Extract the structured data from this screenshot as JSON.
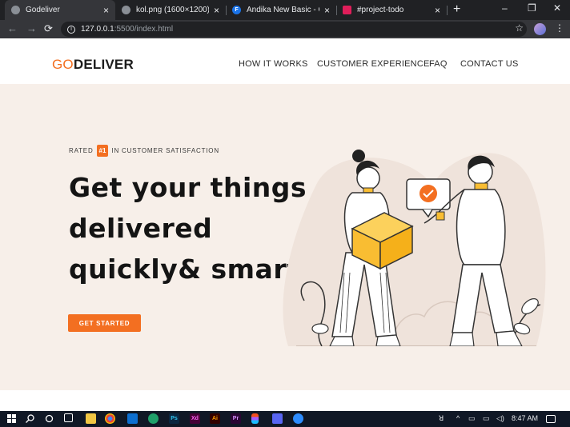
{
  "browser": {
    "tabs": [
      {
        "title": "Godeliver",
        "active": true,
        "favicon_color": "#8a8f96"
      },
      {
        "title": "kol.png (1600×1200)",
        "active": false,
        "favicon_color": "#8a8f96"
      },
      {
        "title": "Andika New Basic - Goog",
        "active": false,
        "favicon_color": "#1a73e8",
        "favicon_letter": "F"
      },
      {
        "title": "#project-todo",
        "active": false,
        "favicon_color": "#e01e5a"
      }
    ],
    "close_glyph": "×",
    "new_tab_glyph": "+",
    "window_controls": [
      "–",
      "❐",
      "✕"
    ],
    "url_host": "127.0.0.1",
    "url_rest": ":5500/index.html",
    "nav_glyphs": {
      "back": "←",
      "forward": "→",
      "reload": "⟳",
      "star": "☆",
      "menu": "⋮"
    }
  },
  "site": {
    "logo_go": "GO",
    "logo_deliver": "DELIVER",
    "nav": [
      "HOW IT WORKS",
      "CUSTOMER EXPERIENCE",
      "FAQ",
      "CONTACT US"
    ],
    "rated_prefix": "RATED",
    "rated_badge": "#1",
    "rated_suffix": "IN CUSTOMER SATISFACTION",
    "headline": [
      "Get your things",
      "delivered",
      "quickly& smartly"
    ],
    "cta_label": "GET STARTED",
    "colors": {
      "accent": "#f36f21",
      "hero_bg": "#f7efe9",
      "box": "#f9bd32"
    }
  },
  "taskbar": {
    "time": "8:47 AM",
    "tray_glyph": "ꓤ"
  }
}
